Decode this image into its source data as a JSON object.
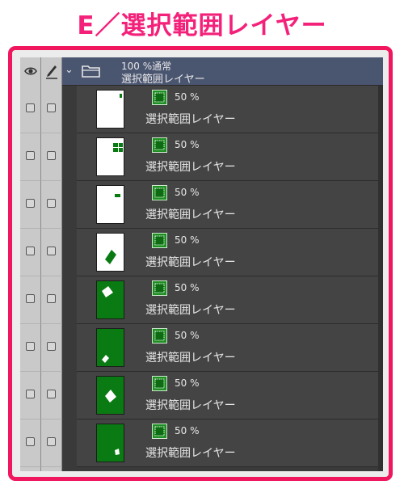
{
  "title": "E／選択範囲レイヤー",
  "folder": {
    "opacity_mode": "100 %通常",
    "name": "選択範囲レイヤー"
  },
  "icons": {
    "visibility": "eye-icon",
    "edit": "pen-icon",
    "expand": "chevron-down-icon",
    "folder": "folder-icon",
    "layer_type": "selection-layer-icon"
  },
  "colors": {
    "title": "#f4217a",
    "frame": "#f0175f",
    "selection_green": "#0a7a12"
  },
  "layers": [
    {
      "opacity": "50 %",
      "name": "選択範囲レイヤー"
    },
    {
      "opacity": "50 %",
      "name": "選択範囲レイヤー"
    },
    {
      "opacity": "50 %",
      "name": "選択範囲レイヤー"
    },
    {
      "opacity": "50 %",
      "name": "選択範囲レイヤー"
    },
    {
      "opacity": "50 %",
      "name": "選択範囲レイヤー"
    },
    {
      "opacity": "50 %",
      "name": "選択範囲レイヤー"
    },
    {
      "opacity": "50 %",
      "name": "選択範囲レイヤー"
    },
    {
      "opacity": "50 %",
      "name": "選択範囲レイヤー"
    }
  ]
}
